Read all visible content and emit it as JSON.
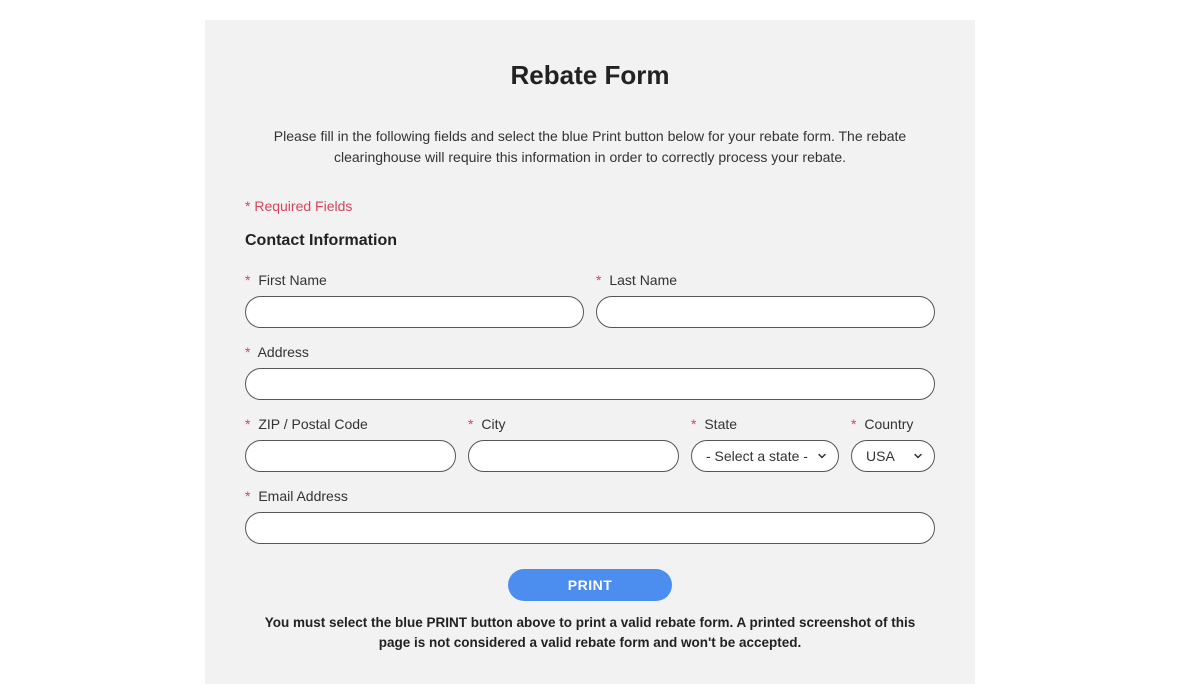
{
  "title": "Rebate Form",
  "instructions": "Please fill in the following fields and select the blue Print button below for your rebate form. The rebate clearinghouse will require this information in order to correctly process your rebate.",
  "requiredNote": "* Required Fields",
  "sectionHeading": "Contact Information",
  "fields": {
    "firstName": {
      "label": "First Name",
      "value": ""
    },
    "lastName": {
      "label": "Last Name",
      "value": ""
    },
    "address": {
      "label": "Address",
      "value": ""
    },
    "zip": {
      "label": "ZIP / Postal Code",
      "value": ""
    },
    "city": {
      "label": "City",
      "value": ""
    },
    "state": {
      "label": "State",
      "selected": "- Select a state -"
    },
    "country": {
      "label": "Country",
      "selected": "USA"
    },
    "email": {
      "label": "Email Address",
      "value": ""
    }
  },
  "asterisk": "*",
  "printButton": "PRINT",
  "disclaimer": "You must select the blue PRINT button above to print a valid rebate form. A printed screenshot of this page is not considered a valid rebate form and won't be accepted."
}
